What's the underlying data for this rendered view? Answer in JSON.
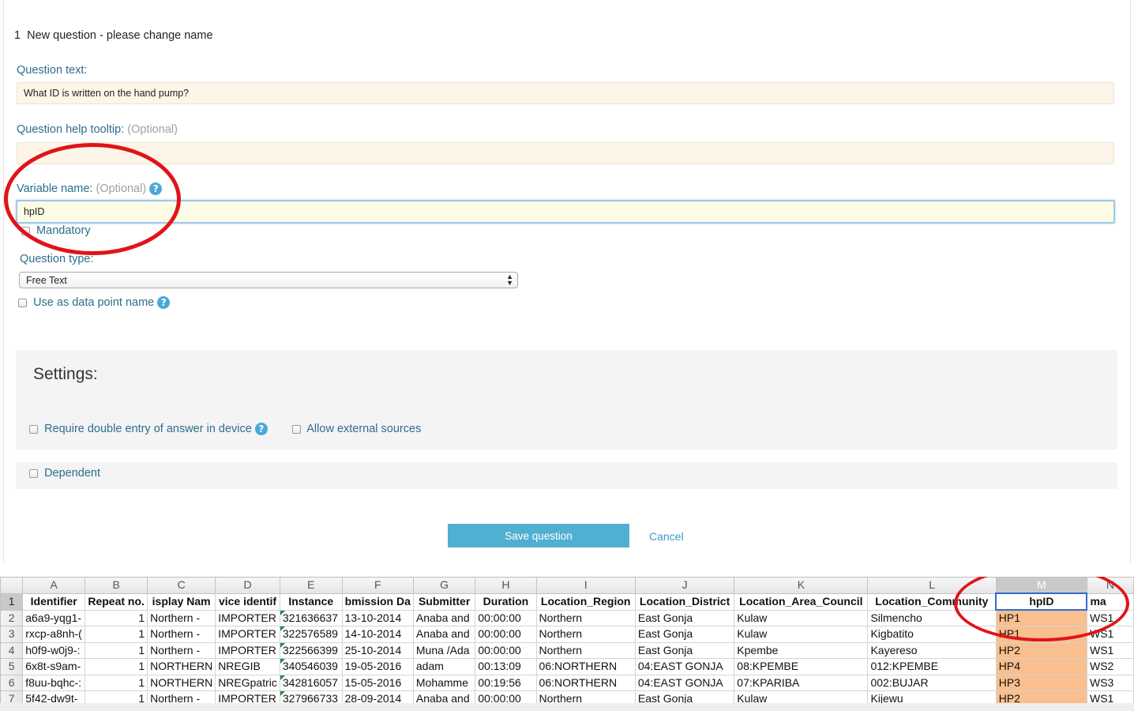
{
  "question": {
    "number": "1",
    "title": "New question - please change name",
    "text_label": "Question text:",
    "text_value": "What ID is written on the hand pump?",
    "tooltip_label": "Question help tooltip:",
    "optional_hint": "(Optional)",
    "tooltip_value": "",
    "variable_label": "Variable name:",
    "variable_value": "hpID",
    "mandatory_label": "Mandatory",
    "type_label": "Question type:",
    "type_value": "Free Text",
    "datapoint_label": "Use as data point name"
  },
  "settings": {
    "title": "Settings:",
    "double_entry_label": "Require double entry of answer in device",
    "external_label": "Allow external sources",
    "dependent_label": "Dependent"
  },
  "actions": {
    "save_label": "Save question",
    "cancel_label": "Cancel"
  },
  "colors": {
    "label_blue": "#2d6d8b",
    "field_bg": "#fdf6e8",
    "button_blue": "#51afd1",
    "annotation_red": "#e0141a",
    "highlight_orange": "#f9bf8e"
  },
  "sheet": {
    "columns": [
      "A",
      "B",
      "C",
      "D",
      "E",
      "F",
      "G",
      "H",
      "I",
      "J",
      "K",
      "L",
      "M",
      "N"
    ],
    "row_numbers": [
      "1",
      "2",
      "3",
      "4",
      "5",
      "6",
      "7"
    ],
    "header": [
      "Identifier",
      "Repeat no.",
      "isplay Nam",
      "vice identif",
      "Instance",
      "bmission Da",
      "Submitter",
      "Duration",
      "Location_Region",
      "Location_District",
      "Location_Area_Council",
      "Location_Community",
      "hpID",
      "ma"
    ],
    "rows": [
      [
        "a6a9-yqg1-",
        "1",
        "Northern -",
        "IMPORTER",
        "321636637",
        "13-10-2014",
        "Anaba and",
        "00:00:00",
        "Northern",
        "East Gonja",
        "Kulaw",
        "Silmencho",
        "HP1",
        "WS1"
      ],
      [
        "rxcp-a8nh-(",
        "1",
        "Northern -",
        "IMPORTER",
        "322576589",
        "14-10-2014",
        "Anaba and",
        "00:00:00",
        "Northern",
        "East Gonja",
        "Kulaw",
        "Kigbatito",
        "HP1",
        "WS1"
      ],
      [
        "h0f9-w0j9-:",
        "1",
        "Northern -",
        "IMPORTER",
        "322566399",
        "25-10-2014",
        "Muna /Ada",
        "00:00:00",
        "Northern",
        "East Gonja",
        "Kpembe",
        "Kayereso",
        "HP2",
        "WS1"
      ],
      [
        "6x8t-s9am-",
        "1",
        "NORTHERN",
        "NREGIB",
        "340546039",
        "19-05-2016",
        "adam",
        "00:13:09",
        "06:NORTHERN",
        "04:EAST GONJA",
        "08:KPEMBE",
        "012:KPEMBE",
        "HP4",
        "WS2"
      ],
      [
        "f8uu-bqhc-:",
        "1",
        "NORTHERN",
        "NREGpatric",
        "342816057",
        "15-05-2016",
        "Mohamme",
        "00:19:56",
        "06:NORTHERN",
        "04:EAST GONJA",
        "07:KPARIBA",
        "002:BUJAR",
        "HP3",
        "WS3"
      ],
      [
        "5f42-dw9t-",
        "1",
        "Northern -",
        "IMPORTER",
        "327966733",
        "28-09-2014",
        "Anaba and",
        "00:00:00",
        "Northern",
        "East Gonja",
        "Kulaw",
        "Kijewu",
        "HP2",
        "WS1"
      ]
    ]
  }
}
